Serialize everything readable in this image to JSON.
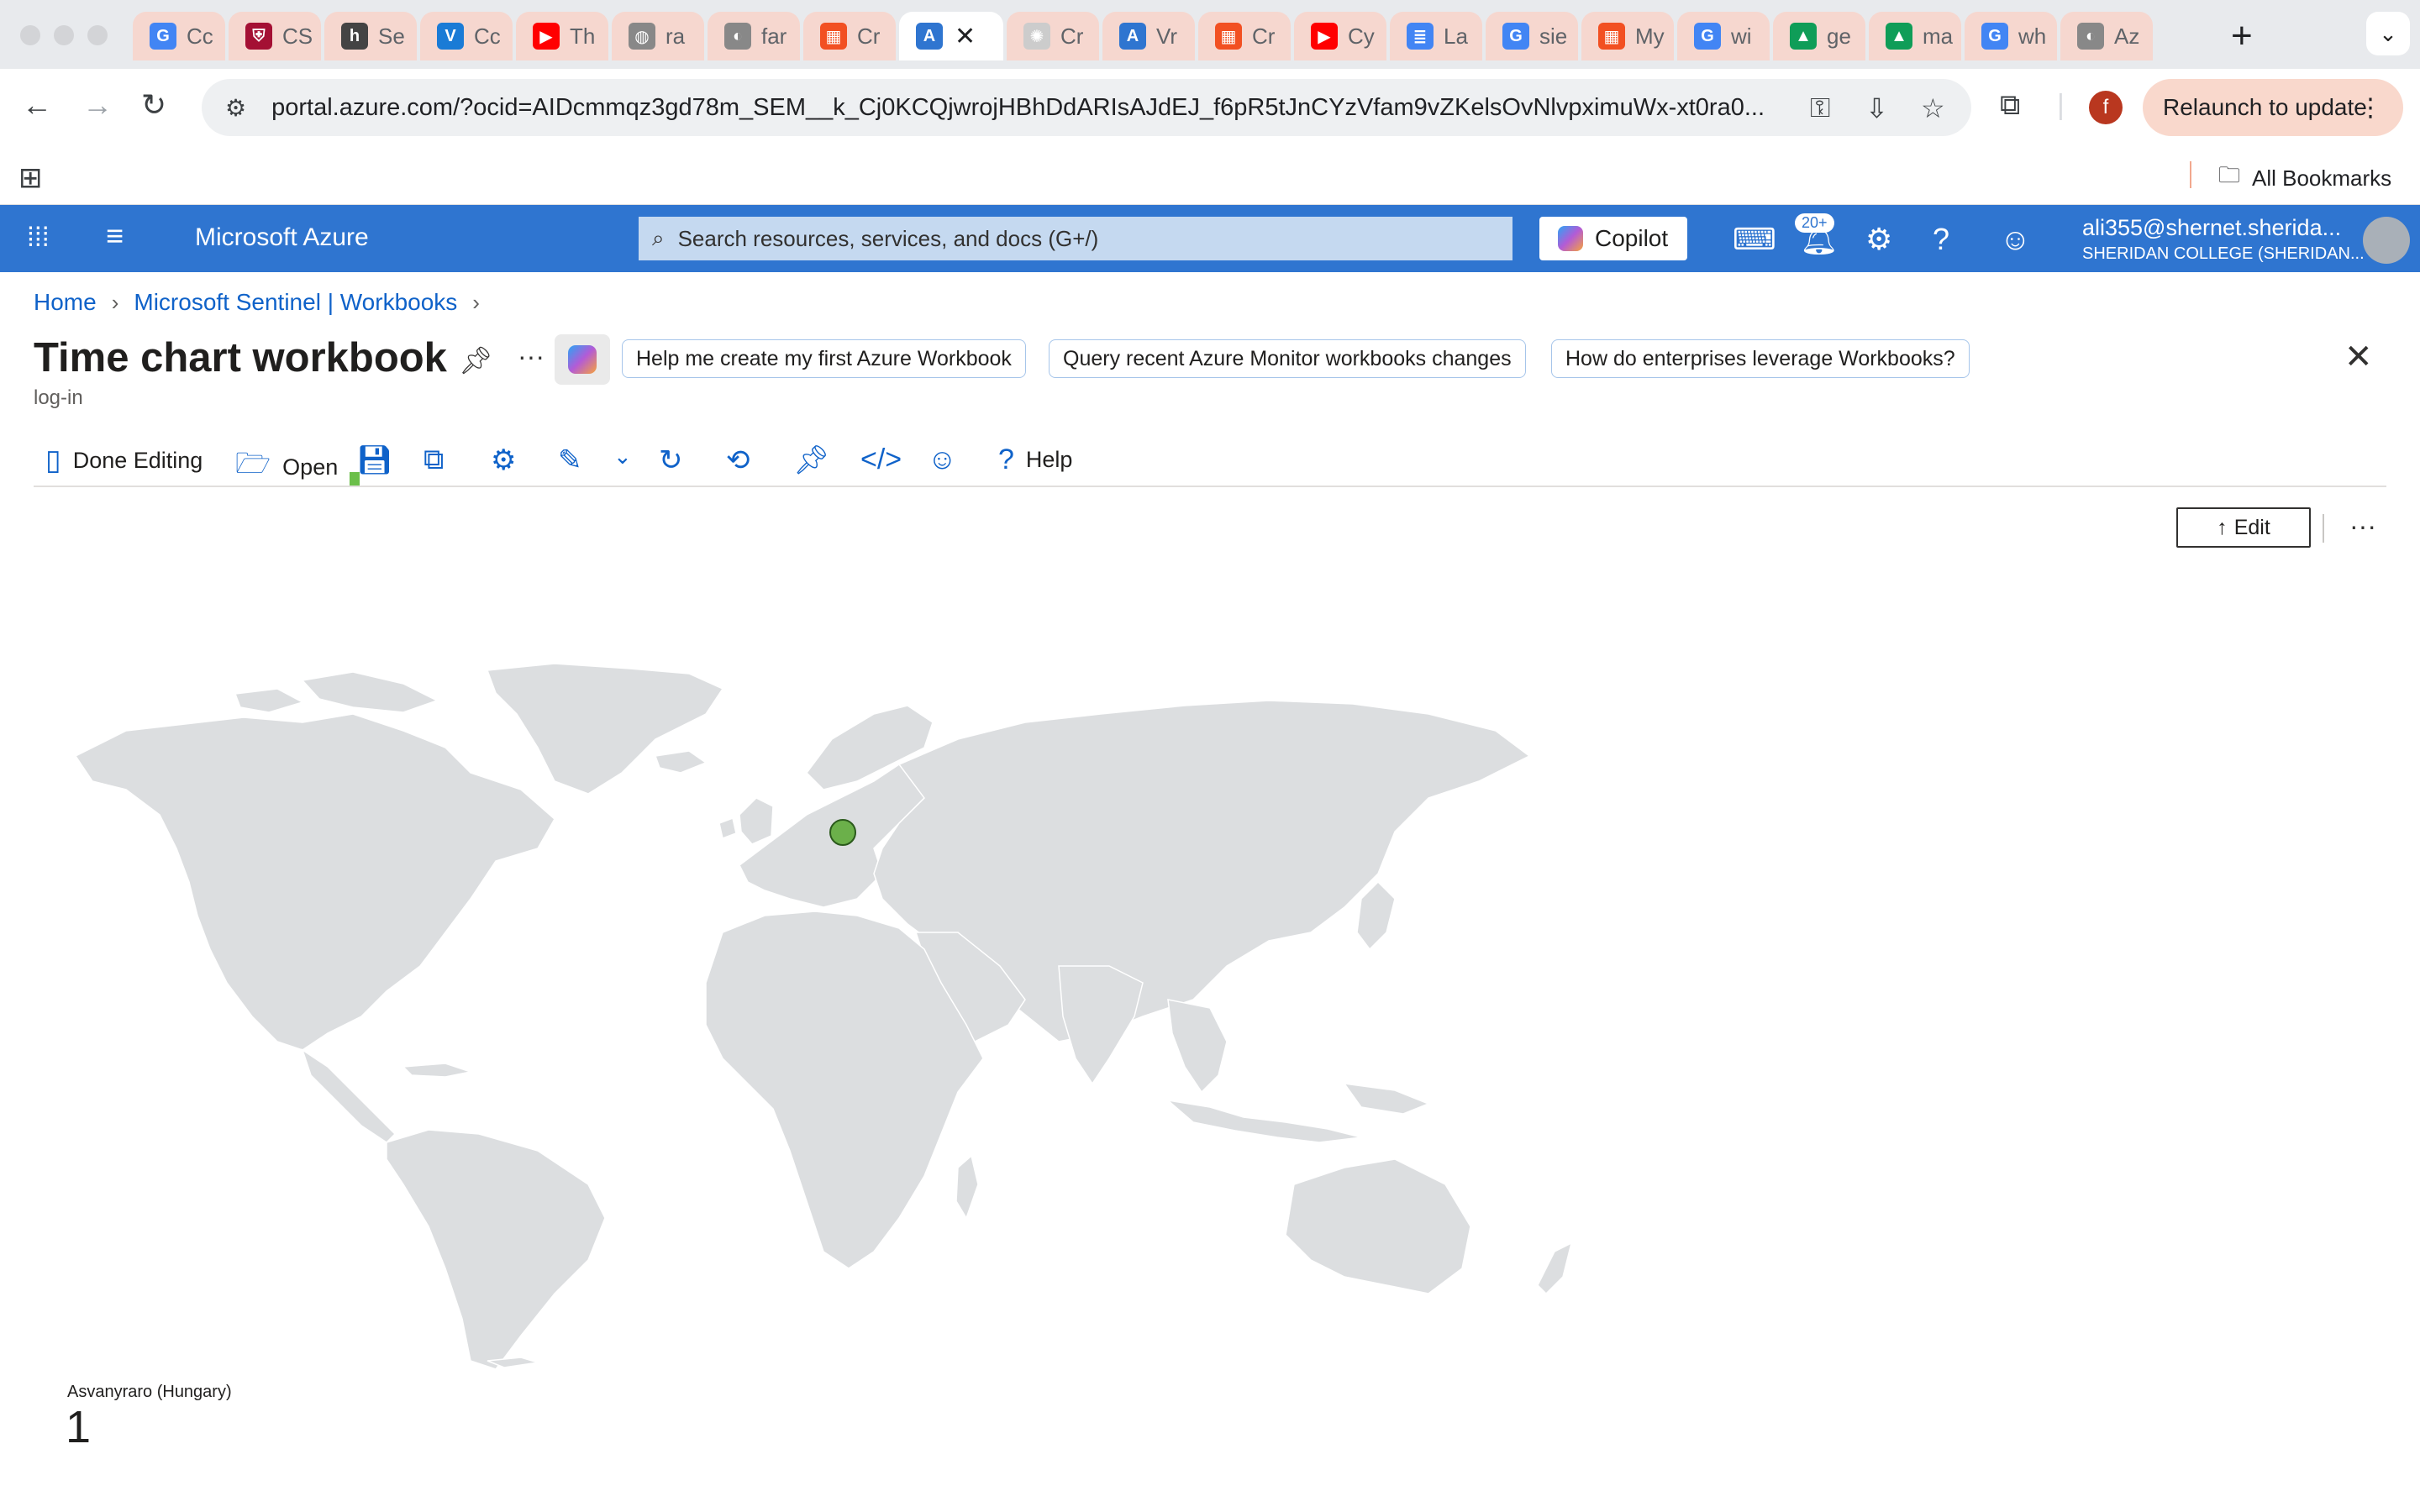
{
  "browser": {
    "tabs": [
      {
        "title": "Cc",
        "icon": "g-icon",
        "color": "#4285f4"
      },
      {
        "title": "CS",
        "icon": "shield-icon",
        "color": "#a41034"
      },
      {
        "title": "Se",
        "icon": "hp-icon",
        "color": "#444444"
      },
      {
        "title": "Cc",
        "icon": "v-icon",
        "color": "#1a7bd6"
      },
      {
        "title": "Th",
        "icon": "youtube-icon",
        "color": "#ff0000"
      },
      {
        "title": "ra",
        "icon": "globe-icon",
        "color": "#888888"
      },
      {
        "title": "far",
        "icon": "github-icon",
        "color": "#888888"
      },
      {
        "title": "Cr",
        "icon": "microsoft-icon",
        "color": "#f25022"
      },
      {
        "title": "",
        "icon": "azure-icon",
        "color": "#2f75d0",
        "active": true
      },
      {
        "title": "Cr",
        "icon": "openai-icon",
        "color": "#cccccc"
      },
      {
        "title": "Vr",
        "icon": "azure-icon",
        "color": "#2f75d0"
      },
      {
        "title": "Cr",
        "icon": "microsoft-icon",
        "color": "#f25022"
      },
      {
        "title": "Cy",
        "icon": "youtube-icon",
        "color": "#ff0000"
      },
      {
        "title": "La",
        "icon": "docs-icon",
        "color": "#4285f4"
      },
      {
        "title": "sie",
        "icon": "google-icon",
        "color": "#4285f4"
      },
      {
        "title": "My",
        "icon": "microsoft-icon",
        "color": "#f25022"
      },
      {
        "title": "wi",
        "icon": "google-icon",
        "color": "#4285f4"
      },
      {
        "title": "ge",
        "icon": "drive-icon",
        "color": "#0f9d58"
      },
      {
        "title": "ma",
        "icon": "drive-icon",
        "color": "#0f9d58"
      },
      {
        "title": "wh",
        "icon": "google-icon",
        "color": "#4285f4"
      },
      {
        "title": "Az",
        "icon": "github-icon",
        "color": "#888888"
      }
    ],
    "url": "portal.azure.com/?ocid=AIDcmmqz3gd78m_SEM__k_Cj0KCQjwrojHBhDdARIsAJdEJ_f6pR5tJnCYzVfam9vZKelsOvNlvpximuWx-xt0ra0...",
    "relaunch_label": "Relaunch to update",
    "profile_initial": "f",
    "all_bookmarks": "All Bookmarks"
  },
  "azure": {
    "brand": "Microsoft Azure",
    "search_placeholder": "Search resources, services, and docs (G+/)",
    "copilot_label": "Copilot",
    "notifications_badge": "20+",
    "account_email": "ali355@shernet.sherida...",
    "account_org": "SHERIDAN COLLEGE (SHERIDAN...",
    "brand_color": "#2f75d0"
  },
  "breadcrumb": [
    "Home",
    "Microsoft Sentinel | Workbooks"
  ],
  "page": {
    "title": "Time chart workbook",
    "subtitle": "log-in",
    "suggestions": [
      "Help me create my first Azure Workbook",
      "Query recent Azure Monitor workbooks changes",
      "How do enterprises leverage Workbooks?"
    ]
  },
  "commands": {
    "done_editing": "Done Editing",
    "open": "Open",
    "help": "Help",
    "edit": "Edit"
  },
  "map": {
    "points": [
      {
        "location": "Asvanyraro (Hungary)",
        "count": "1",
        "lat": 47.8,
        "lon": 17.5,
        "color": "#6bb04a"
      }
    ]
  }
}
